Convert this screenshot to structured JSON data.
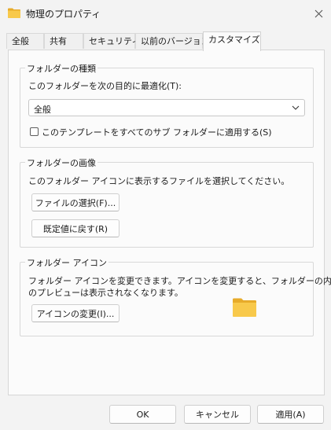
{
  "window": {
    "title": "物理のプロパティ"
  },
  "tabs": [
    {
      "label": "全般"
    },
    {
      "label": "共有"
    },
    {
      "label": "セキュリティ"
    },
    {
      "label": "以前のバージョン"
    },
    {
      "label": "カスタマイズ",
      "active": true
    }
  ],
  "folder_type": {
    "group_label": "フォルダーの種類",
    "optimize_label": "このフォルダーを次の目的に最適化(T):",
    "selected_value": "全般",
    "apply_subfolders_label": "このテンプレートをすべてのサブ フォルダーに適用する(S)",
    "apply_subfolders_checked": false
  },
  "folder_picture": {
    "group_label": "フォルダーの画像",
    "description": "このフォルダー アイコンに表示するファイルを選択してください。",
    "choose_file_button": "ファイルの選択(F)...",
    "restore_default_button": "既定値に戻す(R)"
  },
  "folder_icon": {
    "group_label": "フォルダー アイコン",
    "description_line1": "フォルダー アイコンを変更できます。アイコンを変更すると、フォルダーの内容",
    "description_line2": "のプレビューは表示されなくなります。",
    "change_icon_button": "アイコンの変更(I)..."
  },
  "footer": {
    "ok_button": "OK",
    "cancel_button": "キャンセル",
    "apply_button": "適用(A)"
  },
  "colors": {
    "folder_yellow": "#f8c94b",
    "folder_dark": "#e7ab2a",
    "window_bg": "#f3f3f3"
  }
}
